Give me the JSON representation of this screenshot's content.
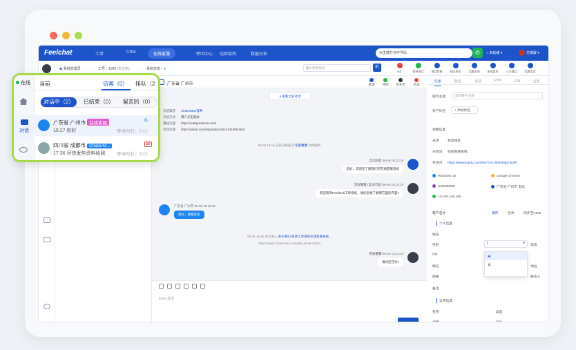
{
  "brand": {
    "logo": "Feelchat",
    "accent": "#1d54c9",
    "highlight": "#a8d948"
  },
  "topnav": {
    "items": [
      "工单",
      "CRM",
      "在线客服",
      "呼叫中心",
      "组织架构",
      "数据分析"
    ],
    "active": "在线客服",
    "search_placeholder": "点击拨打外呼号码",
    "status": "未就绪",
    "user": "方媛媛"
  },
  "toolbar": {
    "role": "系统管理员",
    "work_no": "工号：1000",
    "work_note": "(未注册)",
    "sys_status_label": "系统状态：",
    "dial_placeholder": "输入外呼号码",
    "tools": [
      "示忙",
      "保持通话",
      "通话转移",
      "服务质检",
      "话题咨询",
      "来电监控",
      "三方通话",
      "话题会议"
    ]
  },
  "overlay": {
    "online_label": "在线",
    "chat_nav_label": "对话",
    "current_label": "当前",
    "visitors_label": "访客（0）",
    "queue_label": "排队（2",
    "segments": [
      "对话中（2）",
      "已结束（0）",
      "留言的（0）"
    ],
    "conversations": [
      {
        "location": "广东省 广州市",
        "tag": "在线客服",
        "time": "15:27",
        "preview": "你好",
        "wait": "等待时长：0'12",
        "badge": "G"
      },
      {
        "location": "四川省 成都市",
        "tag": "ChaterM...",
        "time": "17:36",
        "preview": "尽快发些资料给我",
        "wait": "等待时长：3'22",
        "badge": "50"
      }
    ]
  },
  "chat": {
    "title": "广东省 广州市",
    "header_actions": [
      "邀请",
      "转接",
      "黑名单",
      "结束"
    ],
    "history_btn": "查看之前对话",
    "meta": [
      {
        "k": "对话渠道",
        "v": "ChaterMan官网",
        "link": true
      },
      {
        "k": "对话方式",
        "v": "用户点击图标",
        "link": false
      },
      {
        "k": "着陆页面",
        "v": "https://webgradients.com/",
        "link": false
      },
      {
        "k": "对话页面",
        "v": "https://uiiiuiii.com/inspiration/1616141665.html",
        "link": false
      }
    ],
    "sys1_pre": "06-06 16:15 这条分配成功",
    "sys1_link": "客服馨馨",
    "sys1_post": "为你服务",
    "bot_who": "自动回复 06-06 16:13:19",
    "bot_msg": "您好，欢迎您了解我们的在线客服系统",
    "agent1_who": "客服馨馨 [自动回复] 06-06 16:13:19",
    "agent1_msg": "欢迎来到Feeldesk工单系统，请问您想了解哪方面的内容?",
    "visitor_who": "广东省 广州市 06-06 16:13:19",
    "visitor_msg": "您好，我想咨询",
    "sys2_pre": "06-06 16:15 对方进入",
    "sys2_link": "关于我们-开源工单系统在线客服系统...",
    "sys2_url": "https://www.chaterman.com/about/index.html",
    "agent2_who": "客服馨馨 06-06 16:13:19",
    "agent2_msg": "请问还在吗?",
    "input_placeholder": "Enter发送"
  },
  "panel": {
    "tabs": [
      "信息",
      "轨迹",
      "历史",
      "CRM",
      "工单",
      "业务"
    ],
    "subject_label": "服务主题",
    "subject_placeholder": "填写服务主题",
    "tags_label": "客户标签",
    "add_tag": "+ 添加标签",
    "visit_title": "访客信息",
    "source_label": "来源",
    "source_value": "百度搜索",
    "keyword_label": "关键词",
    "keyword_value": "在线客服系统",
    "page_label": "来源页",
    "page_value": "https://www.baidu.com/link?url=3EBvMgO-53fP...",
    "os": "Windows 10",
    "browser": "Google Chrome",
    "device": "web000088",
    "location": "广东省 广州市 电信",
    "ip": "123.66.148.165",
    "card_title": "客户名片",
    "save": "保存",
    "merge": "合并",
    "sync": "同步至CRM",
    "personal": "个人信息",
    "name": "姓名",
    "gender": "性别",
    "phone": "电话",
    "qq": "QQ",
    "wechat": "微信",
    "address": "地址",
    "email": "邮箱",
    "contact": "联系人",
    "remark": "备注",
    "gender_options": [
      "男",
      "女"
    ],
    "company": "公司信息",
    "cname": "名称",
    "ctype": "类型",
    "cscale": "规模",
    "cind": "行业"
  }
}
